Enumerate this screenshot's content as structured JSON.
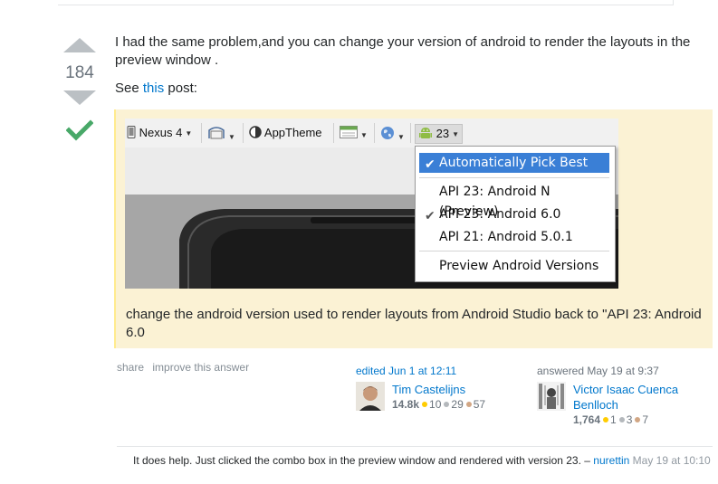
{
  "vote": {
    "count": "184"
  },
  "answer": {
    "paragraph1": "I had the same problem,and you can change your version of android to render the layouts in the preview window .",
    "see_prefix": "See",
    "see_link": "this",
    "see_suffix": "post:"
  },
  "screenshot": {
    "toolbar": {
      "device": "Nexus 4",
      "theme": "AppTheme",
      "api": "23"
    },
    "dropdown": [
      {
        "label": "Automatically Pick Best",
        "checked": true,
        "selected": true
      },
      {
        "label": "API 23: Android N (Preview)",
        "checked": false
      },
      {
        "label": "API 23: Android 6.0",
        "checked": true
      },
      {
        "label": "API 21: Android 5.0.1",
        "checked": false
      },
      {
        "label": "Preview Android Versions",
        "checked": false
      }
    ]
  },
  "quote_text": "change the android version used to render layouts from Android Studio back to \"API 23: Android 6.0",
  "actions": {
    "share": "share",
    "improve": "improve this answer"
  },
  "editor": {
    "when": "edited Jun 1 at 12:11",
    "name": "Tim Castelijns",
    "rep": "14.8k",
    "gold": "10",
    "silver": "29",
    "bronze": "57"
  },
  "author": {
    "when": "answered May 19 at 9:37",
    "name_line1": "Victor Isaac Cuenca",
    "name_line2": "Benlloch",
    "rep": "1,764",
    "gold": "1",
    "silver": "3",
    "bronze": "7"
  },
  "comment": {
    "text": "It does help. Just clicked the combo box in the preview window and rendered with version 23. –",
    "user": "nurettin",
    "date": "May 19 at 10:10"
  },
  "colors": {
    "link": "#0077cc",
    "accepted": "#48a868",
    "quote_bg": "#fbf2d4",
    "gold": "#ffcc01",
    "silver": "#b4b8bc",
    "bronze": "#d1a684"
  }
}
